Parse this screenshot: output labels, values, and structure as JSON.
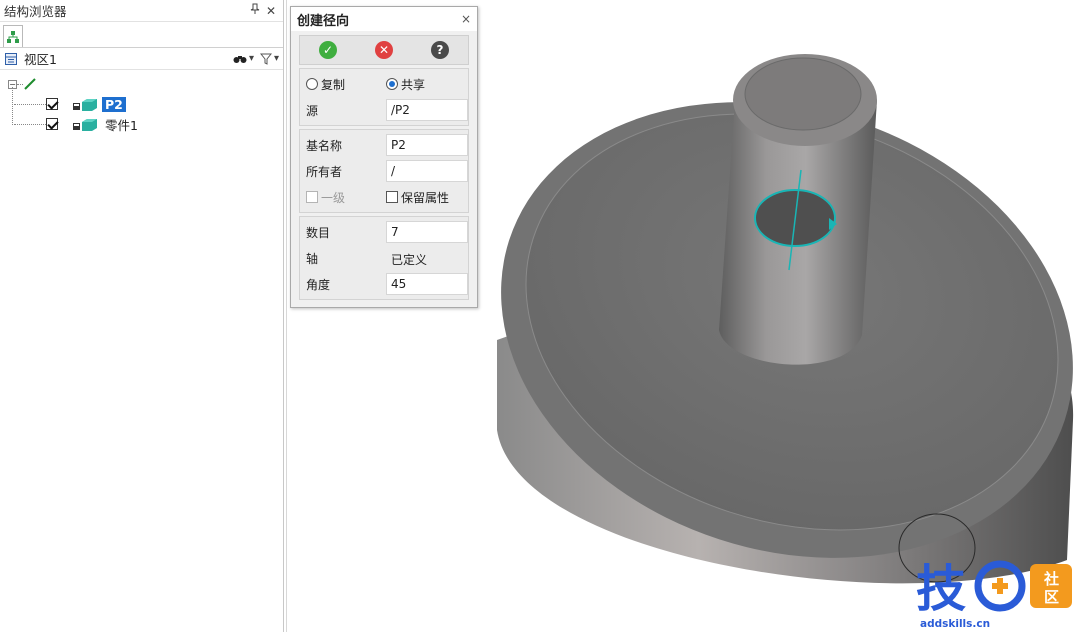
{
  "browser": {
    "title": "结构浏览器",
    "pin_icon": "pin-icon",
    "close_icon": "close-icon",
    "view_label": "视区1",
    "tree": [
      {
        "label": "P2",
        "selected": true,
        "checked": true
      },
      {
        "label": "零件1",
        "selected": false,
        "checked": true
      }
    ]
  },
  "dialog": {
    "title": "创建径向",
    "close_glyph": "×",
    "ok_glyph": "✓",
    "cancel_glyph": "✕",
    "help_glyph": "?",
    "copy_label": "复制",
    "share_label": "共享",
    "share_selected": true,
    "source_label": "源",
    "source_value": "/P2",
    "basename_label": "基名称",
    "basename_value": "P2",
    "owner_label": "所有者",
    "owner_value": "/",
    "first_level_label": "一级",
    "keep_attr_label": "保留属性",
    "count_label": "数目",
    "count_value": "7",
    "axis_label": "轴",
    "axis_value": "已定义",
    "angle_label": "角度",
    "angle_value": "45"
  },
  "watermark": {
    "main_text": "技",
    "badge_text": "社区",
    "site": "addskills.cn"
  },
  "colors": {
    "accent_blue": "#1e6fcf",
    "ok_green": "#3fae3f",
    "cancel_red": "#e04040",
    "model_gray": "#6e6e6e",
    "highlight_cyan": "#19b5b5",
    "watermark_blue": "#2a5bd7",
    "watermark_orange": "#f39a1e"
  }
}
